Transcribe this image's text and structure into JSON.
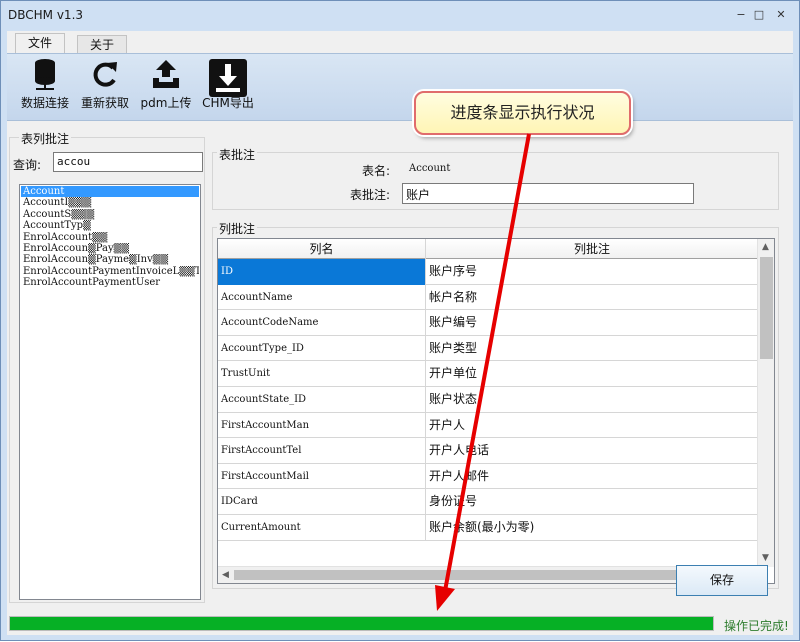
{
  "window": {
    "title": "DBCHM v1.3",
    "min_glyph": "−",
    "max_glyph": "□",
    "close_glyph": "✕"
  },
  "menu": {
    "tabs": [
      {
        "label": "文件"
      },
      {
        "label": "关于"
      }
    ]
  },
  "toolbar": {
    "items": [
      {
        "label": "数据连接",
        "icon": "database-icon"
      },
      {
        "label": "重新获取",
        "icon": "refresh-icon"
      },
      {
        "label": "pdm上传",
        "icon": "upload-icon"
      },
      {
        "label": "CHM导出",
        "icon": "download-icon"
      }
    ]
  },
  "left": {
    "group_title": "表列批注",
    "query_label": "查询:",
    "query_value": "accou",
    "tables": [
      {
        "name": "Account",
        "selected": true
      },
      {
        "name": "AccountI▒▒▒",
        "selected": false
      },
      {
        "name": "AccountS▒▒▒",
        "selected": false
      },
      {
        "name": "AccountTyp▒",
        "selected": false
      },
      {
        "name": "EnrolAccount▒▒",
        "selected": false
      },
      {
        "name": "EnrolAccoun▒Pay▒▒",
        "selected": false
      },
      {
        "name": "EnrolAccoun▒Payme▒Inv▒▒",
        "selected": false
      },
      {
        "name": "EnrolAccountPaymentInvoiceL▒▒T",
        "selected": false
      },
      {
        "name": "EnrolAccountPaymentUser",
        "selected": false
      }
    ]
  },
  "table_comment": {
    "group_title": "表批注",
    "name_label": "表名:",
    "name_value": "Account",
    "comment_label": "表批注:",
    "comment_value": "账户"
  },
  "columns": {
    "group_title": "列批注",
    "headers": [
      "列名",
      "列批注"
    ],
    "rows": [
      {
        "name": "ID",
        "comment": "账户序号",
        "selected": true
      },
      {
        "name": "AccountName",
        "comment": "帐户名称",
        "selected": false
      },
      {
        "name": "AccountCodeName",
        "comment": "账户编号",
        "selected": false
      },
      {
        "name": "AccountType_ID",
        "comment": "账户类型",
        "selected": false
      },
      {
        "name": "TrustUnit",
        "comment": "开户单位",
        "selected": false
      },
      {
        "name": "AccountState_ID",
        "comment": "账户状态",
        "selected": false
      },
      {
        "name": "FirstAccountMan",
        "comment": "开户人",
        "selected": false
      },
      {
        "name": "FirstAccountTel",
        "comment": "开户人电话",
        "selected": false
      },
      {
        "name": "FirstAccountMail",
        "comment": "开户人邮件",
        "selected": false
      },
      {
        "name": "IDCard",
        "comment": "身份证号",
        "selected": false
      },
      {
        "name": "CurrentAmount",
        "comment": "账户余额(最小为零)",
        "selected": false
      }
    ]
  },
  "save_label": "保存",
  "progress": {
    "fraction": 1.0,
    "status": "操作已完成!"
  },
  "callout": {
    "text": "进度条显示执行状况"
  },
  "colors": {
    "selection": "#3399ff",
    "progress": "#06b025",
    "callout_border": "#e06c6c",
    "arrow": "#e60000"
  }
}
